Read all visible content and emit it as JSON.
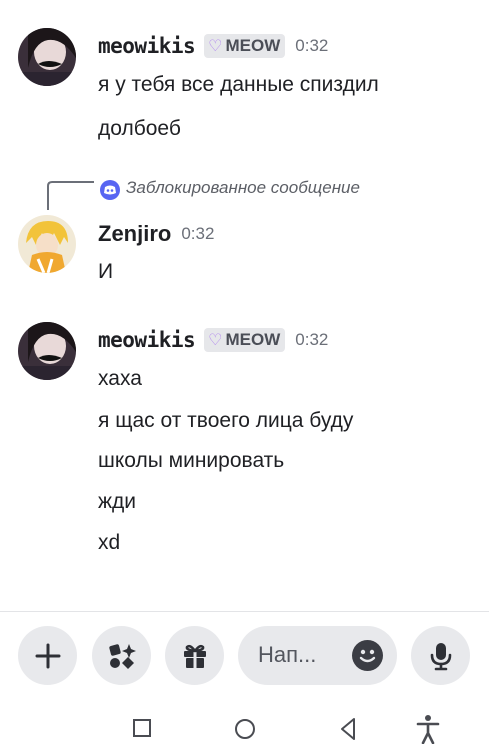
{
  "messages": [
    {
      "avatar": "meowikis-avatar",
      "username": "meowikis",
      "tag": "MEOW",
      "tag_icon": "heart-icon",
      "time": "0:32",
      "lines": [
        "я у тебя все данные спиздил",
        "долбоеб"
      ]
    },
    {
      "reply_preview": "Заблокированное сообщение",
      "avatar": "zenjiro-avatar",
      "username": "Zenjiro",
      "time": "0:32",
      "lines": [
        "И"
      ]
    },
    {
      "avatar": "meowikis-avatar",
      "username": "meowikis",
      "tag": "MEOW",
      "tag_icon": "heart-icon",
      "time": "0:32",
      "lines": [
        "хаха",
        "я щас от твоего лица буду",
        "школы минировать",
        "жди",
        "xd"
      ]
    }
  ],
  "composer": {
    "placeholder": "Нап...",
    "buttons": [
      "plus-icon",
      "apps-icon",
      "gift-icon",
      "emoji-icon",
      "microphone-icon"
    ]
  },
  "navbar": [
    "recent-apps-icon",
    "home-icon",
    "back-icon",
    "accessibility-icon"
  ],
  "colors": {
    "tag_heart": "#b085ee",
    "reply_icon": "#5865f2",
    "bg": "#ffffff"
  }
}
